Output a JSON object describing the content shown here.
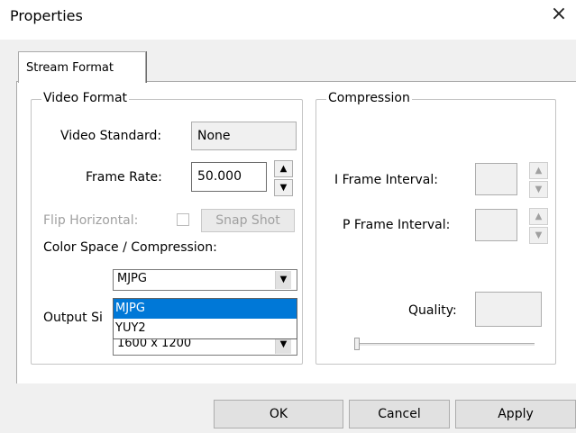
{
  "window": {
    "title": "Properties",
    "close_icon": "×"
  },
  "tabs": [
    {
      "label": "Stream Format",
      "selected": true
    }
  ],
  "video_format": {
    "legend": "Video Format",
    "video_standard_label": "Video Standard:",
    "video_standard_value": "None",
    "frame_rate_label": "Frame Rate:",
    "frame_rate_value": "50.000",
    "flip_horizontal_label": "Flip Horizontal:",
    "snap_shot_label": "Snap Shot",
    "color_space_label": "Color Space / Compression:",
    "color_space_selected": "MJPG",
    "color_space_options": [
      "MJPG",
      "YUY2"
    ],
    "output_size_label": "Output Si",
    "output_size_value": "1600 x 1200"
  },
  "compression": {
    "legend": "Compression",
    "i_frame_label": "I Frame Interval:",
    "p_frame_label": "P Frame Interval:",
    "quality_label": "Quality:",
    "quality_slider_fraction": 0.0
  },
  "buttons": {
    "ok": "OK",
    "cancel": "Cancel",
    "apply": "Apply"
  },
  "glyphs": {
    "spin_up": "▲",
    "spin_down": "▼",
    "combo_arrow": "▼"
  }
}
